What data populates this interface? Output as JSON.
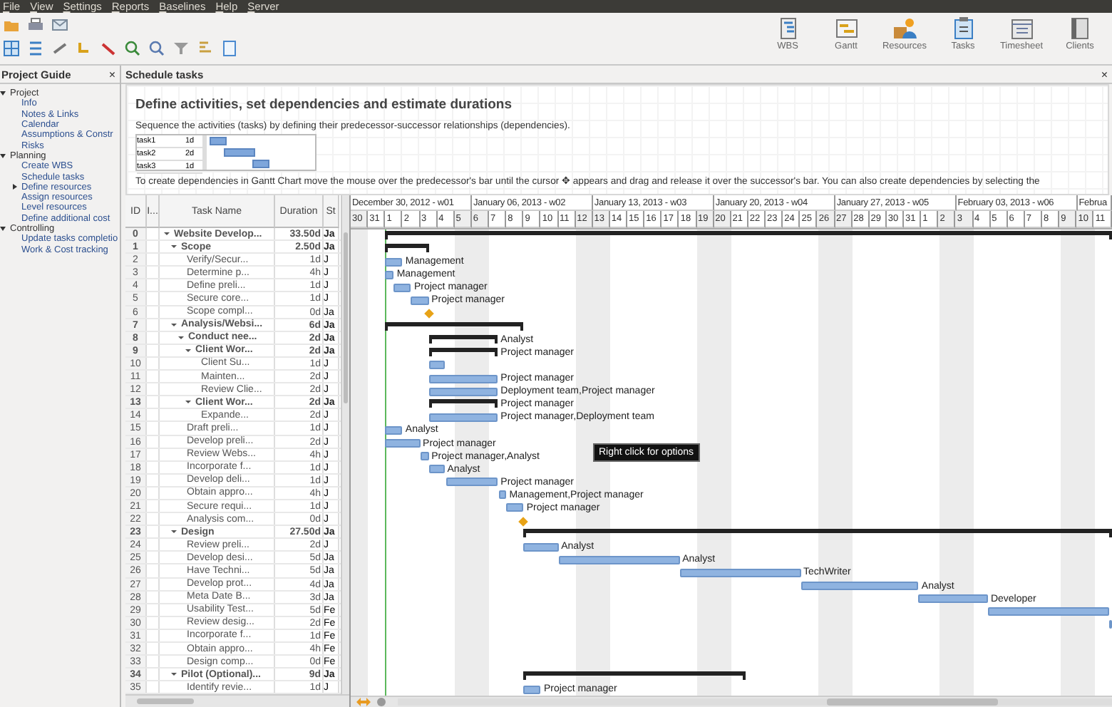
{
  "menu": [
    "File",
    "View",
    "Settings",
    "Reports",
    "Baselines",
    "Help",
    "Server"
  ],
  "views": [
    "WBS",
    "Gantt",
    "Resources",
    "Tasks",
    "Timesheet",
    "Clients"
  ],
  "project_guide": {
    "title": "Project Guide",
    "close": "×",
    "items": [
      {
        "label": "Project",
        "expanded": true,
        "children": [
          {
            "label": "Info"
          },
          {
            "label": "Notes & Links"
          },
          {
            "label": "Calendar"
          },
          {
            "label": "Assumptions & Constr"
          },
          {
            "label": "Risks"
          }
        ]
      },
      {
        "label": "Planning",
        "expanded": true,
        "children": [
          {
            "label": "Create WBS"
          },
          {
            "label": "Schedule tasks"
          },
          {
            "label": "Define resources",
            "expanded": false
          },
          {
            "label": "Assign resources"
          },
          {
            "label": "Level resources"
          },
          {
            "label": "Define additional cost"
          }
        ]
      },
      {
        "label": "Controlling",
        "expanded": true,
        "children": [
          {
            "label": "Update tasks completio"
          },
          {
            "label": "Work & Cost tracking"
          }
        ]
      }
    ]
  },
  "schedule": {
    "tab": "Schedule tasks",
    "close": "×",
    "heading": "Define activities, set dependencies and estimate durations",
    "intro": "Sequence the activities (tasks) by defining their predecessor-successor relationships (dependencies).",
    "example": [
      {
        "task": "task1",
        "duration": "1d"
      },
      {
        "task": "task2",
        "duration": "2d"
      },
      {
        "task": "task3",
        "duration": "1d"
      }
    ],
    "hint": "To create dependencies in Gantt Chart move the mouse over the predecessor's bar until the cursor ✥ appears and drag and release it over the successor's bar. You can also create dependencies by selecting the"
  },
  "table": {
    "columns": [
      "ID",
      "I...",
      "Task Name",
      "Duration",
      "St"
    ],
    "rows": [
      {
        "id": "0",
        "name": "Website Develop...",
        "duration": "33.50d",
        "start": "Ja",
        "expanded": true,
        "bar": {
          "kind": "summary"
        },
        "children": [
          {
            "id": "1",
            "name": "Scope",
            "duration": "2.50d",
            "start": "Ja",
            "expanded": true,
            "bar": {
              "kind": "summary"
            },
            "children": [
              {
                "id": "2",
                "name": "Verify/Secur...",
                "duration": "1d",
                "start": "J",
                "bar": {
                  "kind": "task",
                  "label": "Management"
                }
              },
              {
                "id": "3",
                "name": "Determine p...",
                "duration": "4h",
                "start": "J",
                "bar": {
                  "kind": "task",
                  "label": "Management"
                }
              },
              {
                "id": "4",
                "name": "Define preli...",
                "duration": "1d",
                "start": "J",
                "bar": {
                  "kind": "task",
                  "label": "Project manager"
                }
              },
              {
                "id": "5",
                "name": "Secure core...",
                "duration": "1d",
                "start": "J",
                "bar": {
                  "kind": "task",
                  "label": "Project manager"
                }
              },
              {
                "id": "6",
                "name": "Scope compl...",
                "duration": "0d",
                "start": "Ja",
                "bar": {
                  "kind": "milestone"
                }
              }
            ]
          },
          {
            "id": "7",
            "name": "Analysis/Websi...",
            "duration": "6d",
            "start": "Ja",
            "expanded": true,
            "bar": {
              "kind": "summary"
            },
            "children": [
              {
                "id": "8",
                "name": "Conduct nee...",
                "duration": "2d",
                "start": "Ja",
                "expanded": true,
                "bar": {
                  "kind": "summary",
                  "label": "Analyst"
                },
                "children": [
                  {
                    "id": "9",
                    "name": "Client Wor...",
                    "duration": "2d",
                    "start": "Ja",
                    "expanded": true,
                    "bar": {
                      "kind": "summary",
                      "label": "Project manager"
                    },
                    "children": [
                      {
                        "id": "10",
                        "name": "Client Su...",
                        "duration": "1d",
                        "start": "J",
                        "bar": {
                          "kind": "task"
                        }
                      },
                      {
                        "id": "11",
                        "name": "Mainten...",
                        "duration": "2d",
                        "start": "J",
                        "bar": {
                          "kind": "task",
                          "label": "Project manager"
                        }
                      },
                      {
                        "id": "12",
                        "name": "Review Clie...",
                        "duration": "2d",
                        "start": "J",
                        "bar": {
                          "kind": "task",
                          "label": "Deployment team,Project manager"
                        }
                      }
                    ]
                  },
                  {
                    "id": "13",
                    "name": "Client Wor...",
                    "duration": "2d",
                    "start": "Ja",
                    "expanded": true,
                    "bar": {
                      "kind": "summary",
                      "label": "Project manager"
                    },
                    "children": [
                      {
                        "id": "14",
                        "name": "Expande...",
                        "duration": "2d",
                        "start": "J",
                        "bar": {
                          "kind": "task",
                          "label": "Project manager,Deployment team"
                        }
                      }
                    ]
                  }
                ]
              },
              {
                "id": "15",
                "name": "Draft preli...",
                "duration": "1d",
                "start": "J",
                "bar": {
                  "kind": "task",
                  "label": "Analyst"
                }
              },
              {
                "id": "16",
                "name": "Develop preli...",
                "duration": "2d",
                "start": "J",
                "bar": {
                  "kind": "task",
                  "label": "Project manager"
                }
              },
              {
                "id": "17",
                "name": "Review Webs...",
                "duration": "4h",
                "start": "J",
                "bar": {
                  "kind": "task",
                  "label": "Project manager,Analyst"
                }
              },
              {
                "id": "18",
                "name": "Incorporate f...",
                "duration": "1d",
                "start": "J",
                "bar": {
                  "kind": "task",
                  "label": "Analyst"
                }
              },
              {
                "id": "19",
                "name": "Develop deli...",
                "duration": "1d",
                "start": "J",
                "bar": {
                  "kind": "task",
                  "label": "Project manager"
                }
              },
              {
                "id": "20",
                "name": "Obtain appro...",
                "duration": "4h",
                "start": "J",
                "bar": {
                  "kind": "task",
                  "label": "Management,Project manager"
                }
              },
              {
                "id": "21",
                "name": "Secure requi...",
                "duration": "1d",
                "start": "J",
                "bar": {
                  "kind": "task",
                  "label": "Project manager"
                }
              },
              {
                "id": "22",
                "name": "Analysis com...",
                "duration": "0d",
                "start": "J",
                "bar": {
                  "kind": "milestone"
                }
              }
            ]
          },
          {
            "id": "23",
            "name": "Design",
            "duration": "27.50d",
            "start": "Ja",
            "expanded": true,
            "bar": {
              "kind": "summary"
            },
            "children": [
              {
                "id": "24",
                "name": "Review preli...",
                "duration": "2d",
                "start": "J",
                "bar": {
                  "kind": "task",
                  "label": "Analyst"
                }
              },
              {
                "id": "25",
                "name": "Develop desi...",
                "duration": "5d",
                "start": "Ja",
                "bar": {
                  "kind": "task",
                  "label": "Analyst"
                }
              },
              {
                "id": "26",
                "name": "Have Techni...",
                "duration": "5d",
                "start": "Ja",
                "bar": {
                  "kind": "task",
                  "label": "TechWriter"
                }
              },
              {
                "id": "27",
                "name": "Develop prot...",
                "duration": "4d",
                "start": "Ja",
                "bar": {
                  "kind": "task",
                  "label": "Analyst"
                }
              },
              {
                "id": "28",
                "name": "Meta Date B...",
                "duration": "3d",
                "start": "Ja",
                "bar": {
                  "kind": "task",
                  "label": "Developer"
                }
              },
              {
                "id": "29",
                "name": "Usability Test...",
                "duration": "5d",
                "start": "Fe",
                "bar": {
                  "kind": "task"
                }
              },
              {
                "id": "30",
                "name": "Review desig...",
                "duration": "2d",
                "start": "Fe",
                "bar": {
                  "kind": "task"
                }
              },
              {
                "id": "31",
                "name": "Incorporate f...",
                "duration": "1d",
                "start": "Fe"
              },
              {
                "id": "32",
                "name": "Obtain appro...",
                "duration": "4h",
                "start": "Fe"
              },
              {
                "id": "33",
                "name": "Design comp...",
                "duration": "0d",
                "start": "Fe"
              }
            ]
          },
          {
            "id": "34",
            "name": "Pilot (Optional)...",
            "duration": "9d",
            "start": "Ja",
            "expanded": true,
            "bar": {
              "kind": "summary"
            },
            "children": [
              {
                "id": "35",
                "name": "Identify revie...",
                "duration": "1d",
                "start": "J",
                "bar": {
                  "kind": "task",
                  "label": "Project manager"
                }
              }
            ]
          }
        ]
      }
    ]
  },
  "gantt": {
    "tooltip": "Right click for options",
    "weeks": [
      "December 30, 2012 - w01",
      "January 06, 2013 - w02",
      "January 13, 2013 - w03",
      "January 20, 2013 - w04",
      "January 27, 2013 - w05",
      "February 03, 2013 - w06",
      "Februa"
    ],
    "days": [
      {
        "label": "30",
        "weekend": true
      },
      {
        "label": "31",
        "weekend": false
      },
      {
        "label": "1",
        "weekend": false
      },
      {
        "label": "2",
        "weekend": false
      },
      {
        "label": "3",
        "weekend": false
      },
      {
        "label": "4",
        "weekend": false
      },
      {
        "label": "5",
        "weekend": true
      },
      {
        "label": "6",
        "weekend": true
      },
      {
        "label": "7",
        "weekend": false
      },
      {
        "label": "8",
        "weekend": false
      },
      {
        "label": "9",
        "weekend": false
      },
      {
        "label": "10",
        "weekend": false
      },
      {
        "label": "11",
        "weekend": false
      },
      {
        "label": "12",
        "weekend": true
      },
      {
        "label": "13",
        "weekend": true
      },
      {
        "label": "14",
        "weekend": false
      },
      {
        "label": "15",
        "weekend": false
      },
      {
        "label": "16",
        "weekend": false
      },
      {
        "label": "17",
        "weekend": false
      },
      {
        "label": "18",
        "weekend": false
      },
      {
        "label": "19",
        "weekend": true
      },
      {
        "label": "20",
        "weekend": true
      },
      {
        "label": "21",
        "weekend": false
      },
      {
        "label": "22",
        "weekend": false
      },
      {
        "label": "23",
        "weekend": false
      },
      {
        "label": "24",
        "weekend": false
      },
      {
        "label": "25",
        "weekend": false
      },
      {
        "label": "26",
        "weekend": true
      },
      {
        "label": "27",
        "weekend": true
      },
      {
        "label": "28",
        "weekend": false
      },
      {
        "label": "29",
        "weekend": false
      },
      {
        "label": "30",
        "weekend": false
      },
      {
        "label": "31",
        "weekend": false
      },
      {
        "label": "1",
        "weekend": false
      },
      {
        "label": "2",
        "weekend": true
      },
      {
        "label": "3",
        "weekend": true
      },
      {
        "label": "4",
        "weekend": false
      },
      {
        "label": "5",
        "weekend": false
      },
      {
        "label": "6",
        "weekend": false
      },
      {
        "label": "7",
        "weekend": false
      },
      {
        "label": "8",
        "weekend": false
      },
      {
        "label": "9",
        "weekend": true
      },
      {
        "label": "10",
        "weekend": true
      },
      {
        "label": "11",
        "weekend": false
      }
    ]
  }
}
